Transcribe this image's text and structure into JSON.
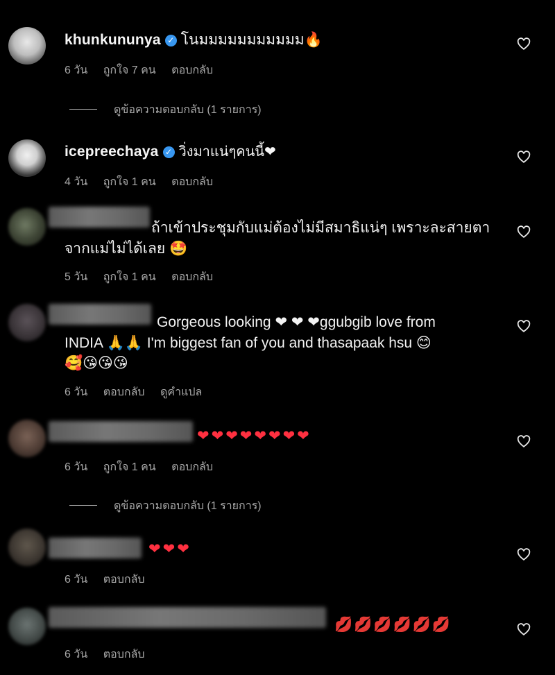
{
  "comments": [
    {
      "username": "khunkununya",
      "verified": true,
      "text": "โนมมมมมมมมมมม🔥",
      "time": "6 วัน",
      "likes": "ถูกใจ 7 คน",
      "reply": "ตอบกลับ",
      "view_replies": "ดูข้อความตอบกลับ (1 รายการ)"
    },
    {
      "username": "icepreechaya",
      "verified": true,
      "text": "วิ่งมาแน่ๆคนนี้❤",
      "time": "4 วัน",
      "likes": "ถูกใจ 1 คน",
      "reply": "ตอบกลับ"
    },
    {
      "text_line1": "ถ้าเข้าประชุมกับแม่ต้องไม่มีสมาธิแน่ๆ เพราะละสายตา",
      "text_line2": "จากแม่ไม่ได้เลย 🤩",
      "time": "5 วัน",
      "likes": "ถูกใจ 1 คน",
      "reply": "ตอบกลับ"
    },
    {
      "text_line1": "Gorgeous looking ❤ ❤ ❤ggubgib love from",
      "text_line2": "INDIA 🙏🙏 I'm biggest fan of you and thasapaak hsu 😊",
      "text_line3": "🥰😘😘😘",
      "time": "6 วัน",
      "reply": "ตอบกลับ",
      "translate": "ดูคำแปล"
    },
    {
      "text": "❤❤❤❤❤❤❤❤",
      "time": "6 วัน",
      "likes": "ถูกใจ 1 คน",
      "reply": "ตอบกลับ",
      "view_replies": "ดูข้อความตอบกลับ (1 รายการ)"
    },
    {
      "text": "❤❤❤",
      "time": "6 วัน",
      "reply": "ตอบกลับ"
    },
    {
      "text": "💋💋💋💋💋💋",
      "time": "6 วัน",
      "reply": "ตอบกลับ"
    }
  ],
  "icons": {
    "like": "heart-outline-icon",
    "verified": "verified-badge-icon"
  },
  "colors": {
    "background": "#000000",
    "verified": "#3897f0",
    "heart": "#ff3040",
    "meta_text": "#a8a8a8"
  }
}
